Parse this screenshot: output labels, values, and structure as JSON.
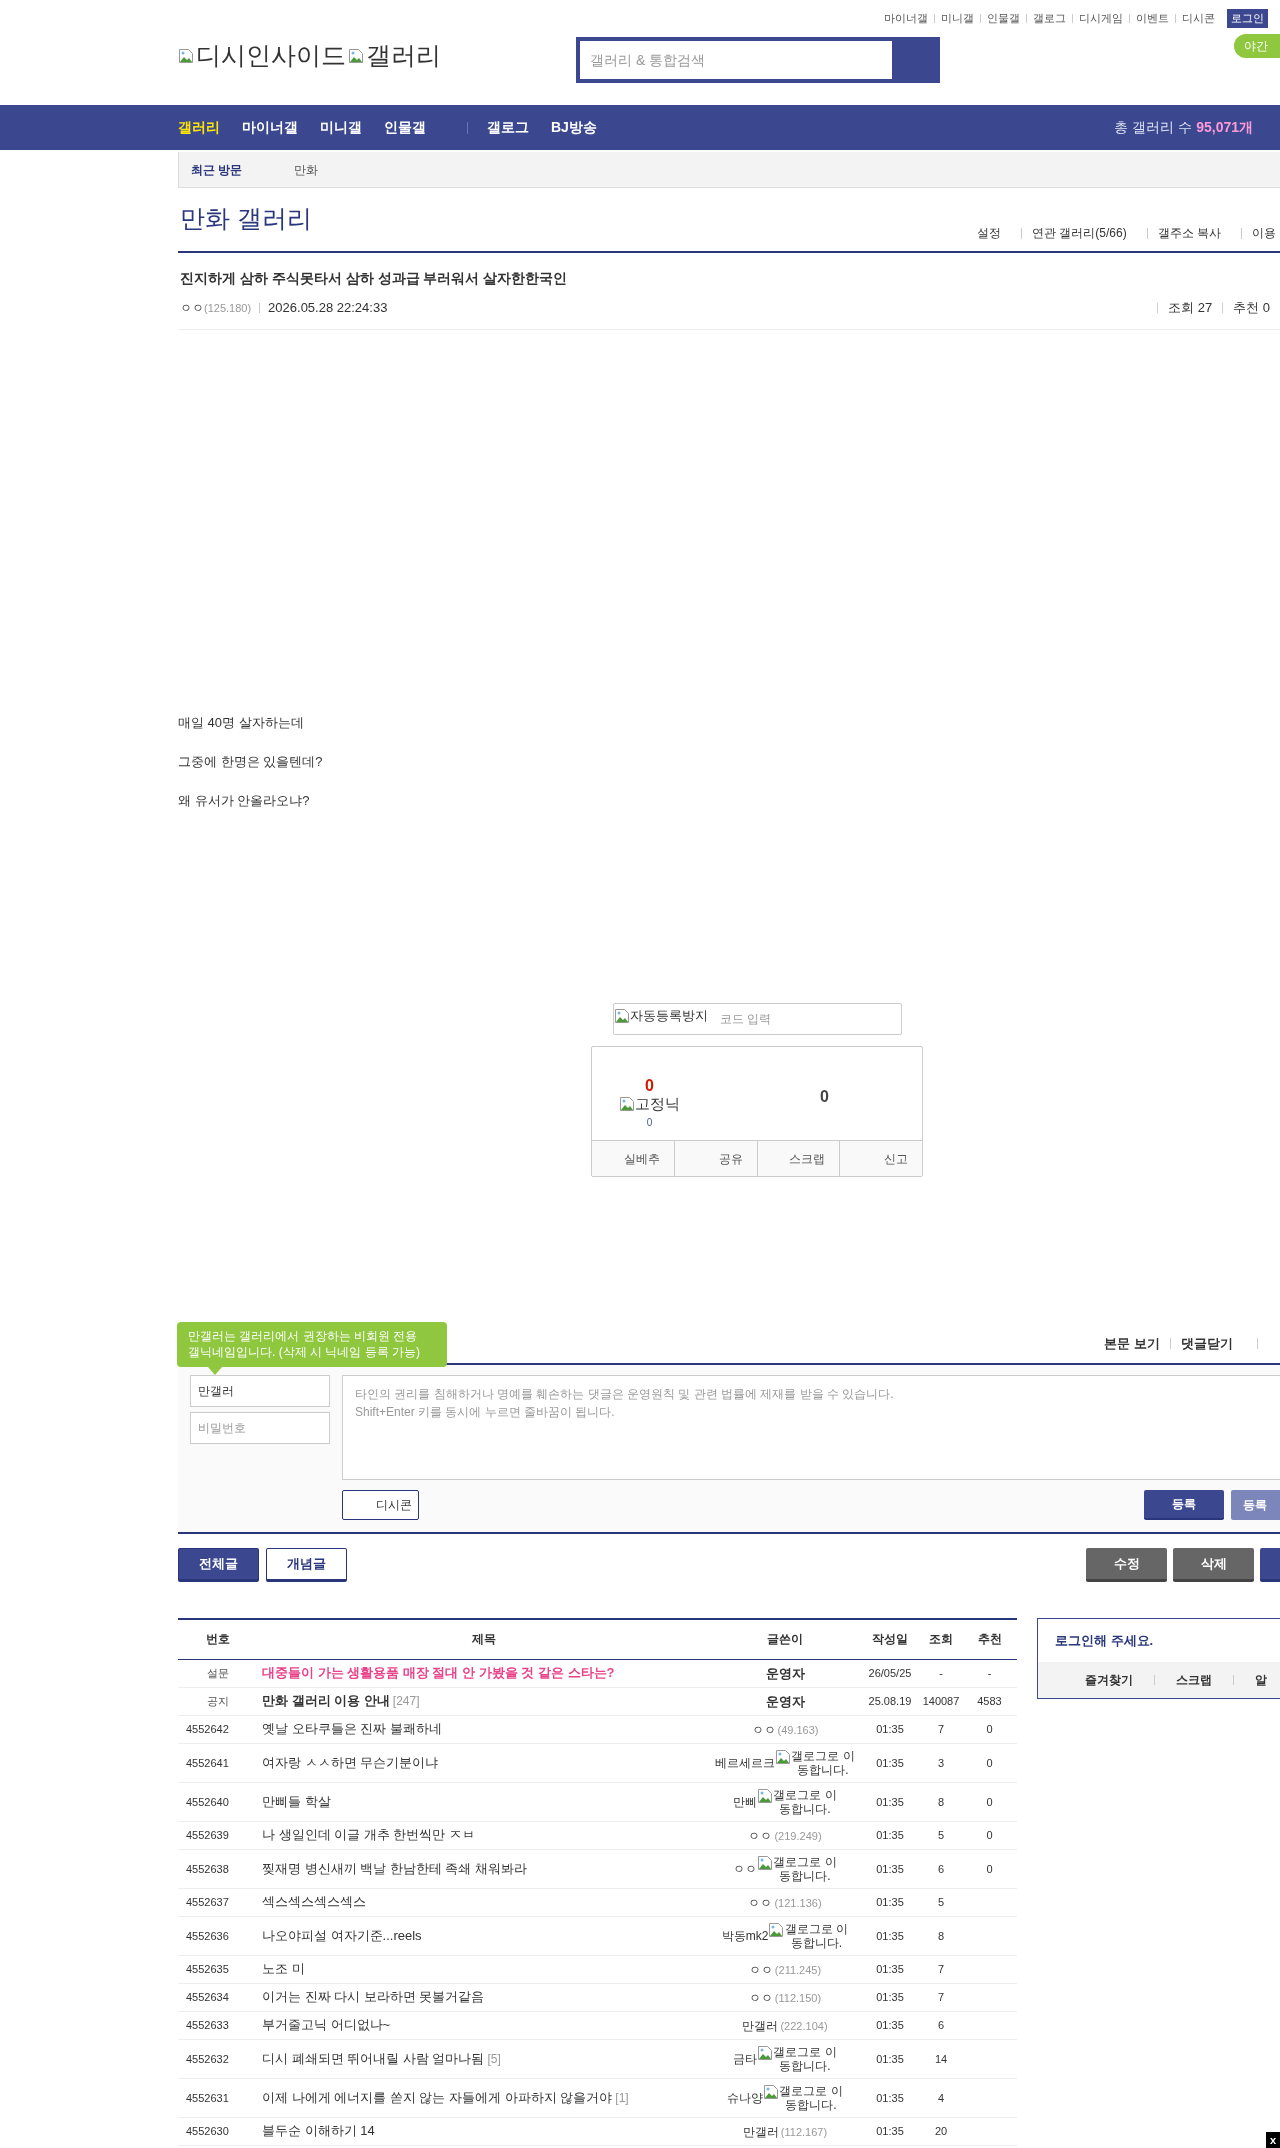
{
  "top_links": [
    "마이너갤",
    "미니갤",
    "인물갤",
    "갤로그",
    "디시게임",
    "이벤트",
    "디시콘"
  ],
  "login_button": "로그인",
  "night_mode_button": "야간",
  "logo": {
    "site_alt": "디시인사이드",
    "gallery_alt": "갤러리"
  },
  "search": {
    "placeholder": "갤러리 & 통합검색"
  },
  "nav": {
    "groups": [
      [
        {
          "label": "갤러리",
          "selected": true
        },
        {
          "label": "마이너갤",
          "selected": false
        },
        {
          "label": "미니갤",
          "selected": false
        },
        {
          "label": "인물갤",
          "selected": false
        }
      ],
      [
        {
          "label": "갤로그",
          "selected": false
        },
        {
          "label": "BJ방송",
          "selected": false
        }
      ]
    ],
    "total_label": "총 갤러리 수",
    "total_count": "95,071개"
  },
  "recent": {
    "label": "최근 방문",
    "items": [
      "만화"
    ]
  },
  "gallery": {
    "title": "만화 갤러리",
    "links": [
      "설정",
      "연관 갤러리(5/66)",
      "갤주소 복사",
      "이용"
    ]
  },
  "post": {
    "title": "진지하게 삼하 주식못타서 삼하 성과급 부러워서 살자한한국인",
    "author": "ㅇㅇ",
    "ip": "(125.180)",
    "date": "2026.05.28 22:24:33",
    "views": "조회 27",
    "recommends": "추천 0",
    "body": [
      "매일 40명 살자하는데",
      "그중에 한명은 있을텐데?",
      "왜 유서가 안올라오냐?"
    ]
  },
  "captcha": {
    "image_alt": "자동등록방지",
    "placeholder": "코드 입력"
  },
  "recommend": {
    "up_count": "0",
    "fixed_nick_alt": "고정닉",
    "fixed_nick_count": "0",
    "down_count": "0",
    "buttons": [
      "실베추",
      "공유",
      "스크랩",
      "신고"
    ]
  },
  "comments": {
    "tooltip": [
      "만갤러는 갤러리에서 권장하는 비회원 전용",
      "갤닉네임입니다. (삭제 시 닉네임 등록 가능)"
    ],
    "links": [
      "본문 보기",
      "댓글닫기"
    ],
    "nickname": "만갤러",
    "password_placeholder": "비밀번호",
    "textarea_placeholder": "타인의 권리를 침해하거나 명예를 훼손하는 댓글은 운영원칙 및 관련 법률에 제재를 받을 수 있습니다.\nShift+Enter 키를 동시에 누르면 줄바꿈이 됩니다.",
    "dccon_button": "디시콘",
    "submit_buttons": [
      "등록",
      "등록"
    ]
  },
  "list_buttons": [
    {
      "label": "전체글",
      "selected": true
    },
    {
      "label": "개념글",
      "selected": false
    }
  ],
  "action_buttons": [
    "수정",
    "삭제"
  ],
  "table": {
    "columns": [
      "번호",
      "제목",
      "글쓴이",
      "작성일",
      "조회",
      "추천"
    ],
    "rows": [
      {
        "kind": "survey",
        "number": "설문",
        "title": "대중들이 가는 생활용품 매장 절대 안 가봤을 것 같은 스타는?",
        "writer": {
          "kind": "admin",
          "name": "운영자"
        },
        "date": "26/05/25",
        "views": "-",
        "recommends": "-"
      },
      {
        "kind": "notice",
        "number": "공지",
        "title": "만화 갤러리 이용 안내",
        "notice_reply_count": "[247]",
        "writer": {
          "kind": "admin",
          "name": "운영자"
        },
        "date": "25.08.19",
        "views": "140087",
        "recommends": "4583"
      },
      {
        "kind": "post",
        "number": "4552642",
        "title": "옛날 오타쿠들은 진짜 불쾌하네",
        "writer": {
          "kind": "ip",
          "name": "ㅇㅇ",
          "ip": "(49.163)"
        },
        "date": "01:35",
        "views": "7",
        "recommends": "0"
      },
      {
        "kind": "post",
        "number": "4552641",
        "title": "여자랑 ㅅㅅ하면 무슨기분이냐",
        "writer": {
          "kind": "gallog",
          "name": "베르세르크",
          "link": "갤로그로 이동합니다."
        },
        "date": "01:35",
        "views": "3",
        "recommends": "0"
      },
      {
        "kind": "post",
        "number": "4552640",
        "title": "만삐들 학살",
        "writer": {
          "kind": "gallog",
          "name": "만삐",
          "link": "갤로그로 이동합니다."
        },
        "date": "01:35",
        "views": "8",
        "recommends": "0"
      },
      {
        "kind": "post",
        "number": "4552639",
        "title": "나 생일인데 이글 개추 한번씩만 ㅈㅂ",
        "writer": {
          "kind": "ip",
          "name": "ㅇㅇ",
          "ip": "(219.249)"
        },
        "date": "01:35",
        "views": "5",
        "recommends": "0"
      },
      {
        "kind": "post",
        "number": "4552638",
        "title": "찢재명 병신새끼 백날 한남한테 족쇄 채워봐라",
        "writer": {
          "kind": "gallog",
          "name": "ㅇㅇ",
          "link": "갤로그로 이동합니다."
        },
        "date": "01:35",
        "views": "6",
        "recommends": "0"
      },
      {
        "kind": "post",
        "number": "4552637",
        "title": "섹스섹스섹스섹스",
        "writer": {
          "kind": "ip",
          "name": "ㅇㅇ",
          "ip": "(121.136)"
        },
        "date": "01:35",
        "views": "5"
      },
      {
        "kind": "post",
        "number": "4552636",
        "title": "나오야피설 여자기준...reels",
        "writer": {
          "kind": "gallog",
          "name": "박동mk2",
          "link": "갤로그로 이동합니다."
        },
        "date": "01:35",
        "views": "8"
      },
      {
        "kind": "post",
        "number": "4552635",
        "title": "노조 미",
        "writer": {
          "kind": "ip",
          "name": "ㅇㅇ",
          "ip": "(211.245)"
        },
        "date": "01:35",
        "views": "7"
      },
      {
        "kind": "post",
        "number": "4552634",
        "title": "이거는 진짜 다시 보라하면 못볼거같음",
        "writer": {
          "kind": "ip",
          "name": "ㅇㅇ",
          "ip": "(112.150)"
        },
        "date": "01:35",
        "views": "7"
      },
      {
        "kind": "post",
        "number": "4552633",
        "title": "부거줄고닉 어디없나~",
        "writer": {
          "kind": "ip",
          "name": "만갤러",
          "ip": "(222.104)"
        },
        "date": "01:35",
        "views": "6"
      },
      {
        "kind": "post",
        "number": "4552632",
        "title": "디시 폐쇄되면 뛰어내릴 사람 얼마나됨",
        "reply_count": "[5]",
        "writer": {
          "kind": "gallog",
          "name": "금타",
          "link": "갤로그로 이동합니다."
        },
        "date": "01:35",
        "views": "14"
      },
      {
        "kind": "post",
        "number": "4552631",
        "title": "이제 나에게 에너지를 쏟지 않는 자들에게 아파하지 않을거야",
        "reply_count": "[1]",
        "writer": {
          "kind": "gallog",
          "name": "슈나양",
          "link": "갤로그로 이동합니다."
        },
        "date": "01:35",
        "views": "4"
      },
      {
        "kind": "post",
        "number": "4552630",
        "title": "블두순 이해하기 14",
        "writer": {
          "kind": "ip",
          "name": "만갤러",
          "ip": "(112.167)"
        },
        "date": "01:35",
        "views": "20"
      }
    ]
  },
  "sidebar": {
    "login_prompt": "로그인해 주세요.",
    "links": [
      "즐겨찾기",
      "스크랩",
      "알"
    ]
  },
  "close_button": "x"
}
